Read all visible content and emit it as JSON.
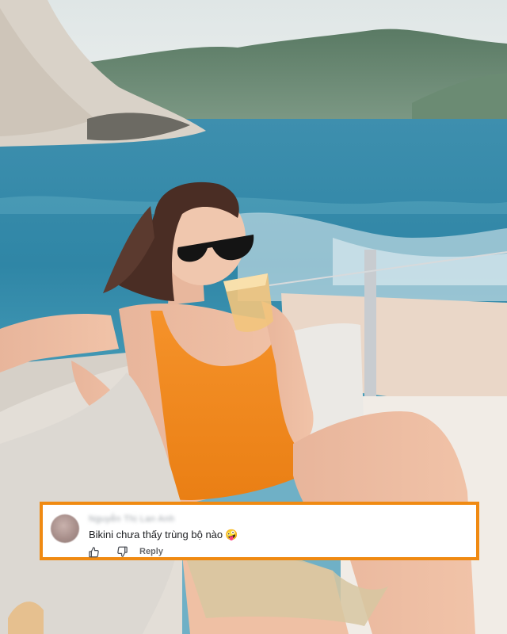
{
  "comment": {
    "author": "Nguyễn Thị Lan Anh",
    "text": "Bikini chưa thấy trùng bộ nào",
    "emoji": "🤪",
    "reply_label": "Reply"
  },
  "icons": {
    "like": "thumbs-up-icon",
    "dislike": "thumbs-down-icon"
  },
  "colors": {
    "card_border": "#f08a12",
    "swimsuit": "#f28a1f",
    "sea": "#3c93b3"
  }
}
